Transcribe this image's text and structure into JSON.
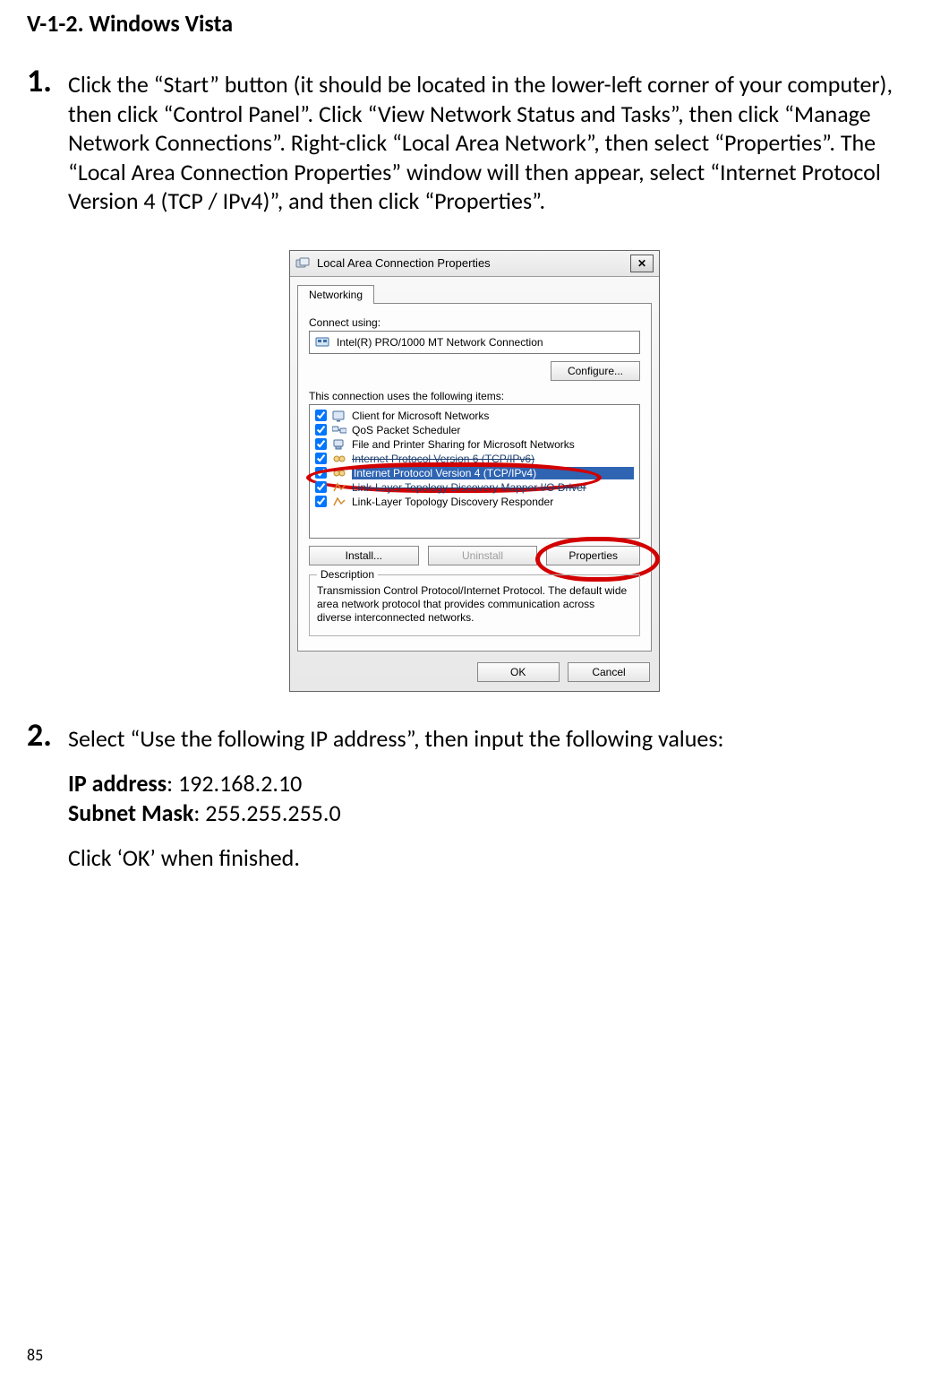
{
  "section_heading": "V-1-2.    Windows Vista",
  "step1": {
    "num": "1.",
    "text": "Click the “Start” button (it should be located in the lower-left corner of your computer), then click “Control Panel”. Click “View Network Status and Tasks”, then click “Manage Network Connections”. Right-click “Local Area Network”, then select “Properties”. The “Local Area Connection Properties” window will then appear, select “Internet Protocol Version 4 (TCP / IPv4)”, and then click “Properties”."
  },
  "step2": {
    "num": "2.",
    "intro": "Select “Use the following IP address”, then input the following values:",
    "ip_label": "IP address",
    "ip_value": ": 192.168.2.10",
    "subnet_label": "Subnet Mask",
    "subnet_value": ": 255.255.255.0",
    "closing": "Click ‘OK’ when finished."
  },
  "page_number": "85",
  "dialog": {
    "title": "Local Area Connection Properties",
    "close_glyph": "✕",
    "tab_label": "Networking",
    "connect_using_label": "Connect using:",
    "nic_name": "Intel(R) PRO/1000 MT Network Connection",
    "configure_btn": "Configure...",
    "items_label": "This connection uses the following items:",
    "items": [
      "Client for Microsoft Networks",
      "QoS Packet Scheduler",
      "File and Printer Sharing for Microsoft Networks",
      "Internet Protocol Version 6 (TCP/IPv6)",
      "Internet Protocol Version 4 (TCP/IPv4)",
      "Link-Layer Topology Discovery Mapper I/O Driver",
      "Link-Layer Topology Discovery Responder"
    ],
    "install_btn": "Install...",
    "uninstall_btn": "Uninstall",
    "properties_btn": "Properties",
    "desc_legend": "Description",
    "desc_text": "Transmission Control Protocol/Internet Protocol. The default wide area network protocol that provides communication across diverse interconnected networks.",
    "ok_btn": "OK",
    "cancel_btn": "Cancel"
  }
}
